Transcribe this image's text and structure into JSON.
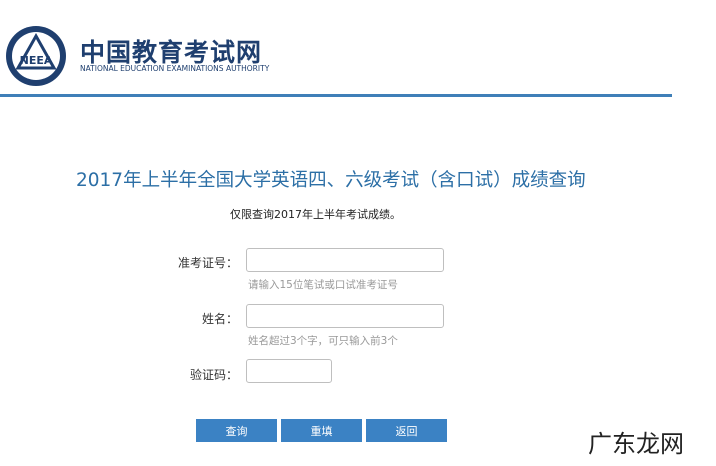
{
  "header": {
    "logo_title": "中国教育考试网",
    "logo_subtitle": "NATIONAL EDUCATION EXAMINATIONS AUTHORITY",
    "emblem_text": "NEEA",
    "accent_color": "#3f7fb8"
  },
  "main": {
    "title": "2017年上半年全国大学英语四、六级考试（含口试）成绩查询",
    "notice": "仅限查询2017年上半年考试成绩。",
    "form": {
      "ticket_label": "准考证号：",
      "ticket_value": "",
      "ticket_hint": "请输入15位笔试或口试准考证号",
      "name_label": "姓名：",
      "name_value": "",
      "name_hint": "姓名超过3个字，可只输入前3个",
      "captcha_label": "验证码：",
      "captcha_value": ""
    },
    "buttons": {
      "query": "查询",
      "reset": "重填",
      "back": "返回"
    }
  },
  "watermark": "广东龙网"
}
